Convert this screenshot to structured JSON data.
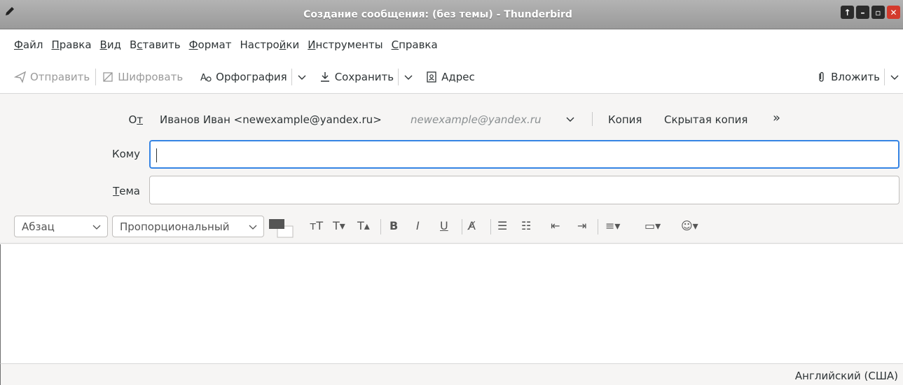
{
  "window": {
    "title": "Создание сообщения: (без темы) - Thunderbird",
    "buttons": [
      "maximize",
      "minimize",
      "restore",
      "close"
    ]
  },
  "menu": [
    {
      "pre": "",
      "u": "Ф",
      "post": "айл"
    },
    {
      "pre": "",
      "u": "П",
      "post": "равка"
    },
    {
      "pre": "",
      "u": "В",
      "post": "ид"
    },
    {
      "pre": "В",
      "u": "с",
      "post": "тавить"
    },
    {
      "pre": "",
      "u": "Ф",
      "post": "ормат"
    },
    {
      "pre": "Настро",
      "u": "й",
      "post": "ки"
    },
    {
      "pre": "",
      "u": "И",
      "post": "нструменты"
    },
    {
      "pre": "",
      "u": "С",
      "post": "правка"
    }
  ],
  "toolbar": {
    "send": "Отправить",
    "encrypt": "Шифровать",
    "spelling": "Орфография",
    "save": "Сохранить",
    "address": "Адрес",
    "attach": "Вложить"
  },
  "headers": {
    "from_label_pre": "О",
    "from_label_u": "т",
    "from_value": "Иванов Иван <newexample@yandex.ru>",
    "from_email": "newexample@yandex.ru",
    "cc": "Копия",
    "bcc": "Скрытая копия",
    "more": "»",
    "to_label": "Кому",
    "to_value": "",
    "subject_label_u": "Т",
    "subject_label_post": "ема",
    "subject_value": ""
  },
  "format": {
    "paragraph": "Абзац",
    "font": "Пропорциональный",
    "colors": {
      "text": "#555555",
      "background": "#ffffff",
      "focus": "#3584e4"
    }
  },
  "status": {
    "language": "Английский (США)"
  }
}
